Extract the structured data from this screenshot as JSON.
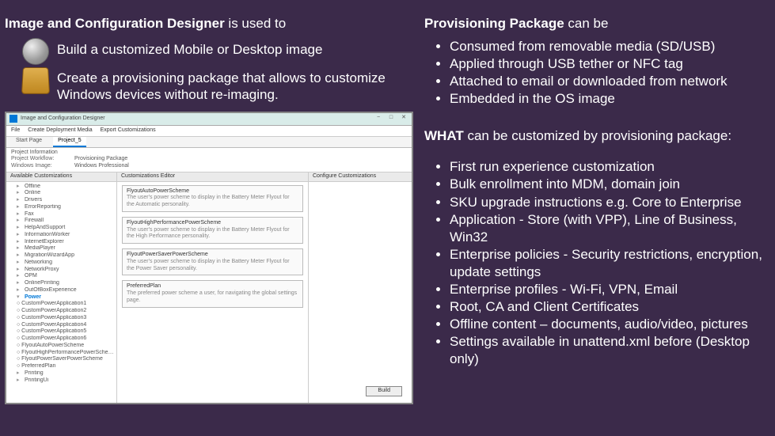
{
  "left": {
    "heading_bold": "Image and Configuration Designer",
    "heading_rest": " is used to",
    "item1": "Build a customized Mobile or Desktop image",
    "item2": "Create a provisioning package that allows to customize Windows devices without re-imaging.",
    "app": {
      "title": "Image and Configuration Designer",
      "menu": {
        "file": "File",
        "create": "Create Deployment Media",
        "export": "Export Customizations"
      },
      "tabs": {
        "start": "Start Page",
        "active": "Project_5"
      },
      "info": {
        "header": "Project Information",
        "workflow_lbl": "Project Workflow:",
        "workflow_val": "Provisioning Package",
        "image_lbl": "Windows Image:",
        "image_val": "Windows Professional"
      },
      "panelA": "Available Customizations",
      "panelB": "Customizations Editor",
      "panelC": "Configure Customizations",
      "tree_nodes": [
        "Offline",
        "Online",
        "Drivers",
        "ErrorReporting",
        "Fax",
        "Firewall",
        "HelpAndSupport",
        "InformationWorker",
        "InternetExplorer",
        "MediaPlayer",
        "MigrationWizardApp",
        "Networking",
        "NetworkProxy",
        "OPM",
        "OnlinePrinting",
        "OutOfBoxExperience",
        "Power"
      ],
      "tree_subs": [
        "CustomPowerApplication1",
        "CustomPowerApplication2",
        "CustomPowerApplication3",
        "CustomPowerApplication4",
        "CustomPowerApplication5",
        "CustomPowerApplication6",
        "FlyoutAutoPowerScheme",
        "FlyoutHighPerformancePowerScheme",
        "FlyoutPowerSaverPowerScheme",
        "PreferredPlan"
      ],
      "tree_tail": [
        "Printing",
        "PrintingUi"
      ],
      "fields": [
        {
          "name": "FlyoutAutoPowerScheme",
          "desc": "The user's power scheme to display in the Battery Meter Flyout for the Automatic personality."
        },
        {
          "name": "FlyoutHighPerformancePowerScheme",
          "desc": "The user's power scheme to display in the Battery Meter Flyout for the High Performance personality."
        },
        {
          "name": "FlyoutPowerSaverPowerScheme",
          "desc": "The user's power scheme to display in the Battery Meter Flyout for the Power Saver personality."
        },
        {
          "name": "PreferredPlan",
          "desc": "The preferred power scheme a user, for navigating the global settings page."
        }
      ],
      "build": "Build"
    }
  },
  "right": {
    "pp_bold": "Provisioning Package",
    "pp_rest": " can be",
    "pp_bullets": [
      "Consumed from removable media (SD/USB)",
      "Applied through USB tether or NFC tag",
      "Attached to email or downloaded from network",
      "Embedded in the OS image"
    ],
    "what_bold": "WHAT",
    "what_rest": " can be customized by provisioning package:",
    "what_bullets": [
      "First run experience customization",
      "Bulk enrollment into MDM, domain join",
      "SKU upgrade instructions e.g. Core to Enterprise",
      "Application - Store (with VPP), Line of Business, Win32",
      "Enterprise policies - Security restrictions, encryption, update settings",
      "Enterprise profiles - Wi-Fi, VPN, Email",
      "Root, CA and Client Certificates",
      "Offline content – documents, audio/video, pictures",
      "Settings available in unattend.xml before (Desktop only)"
    ]
  }
}
